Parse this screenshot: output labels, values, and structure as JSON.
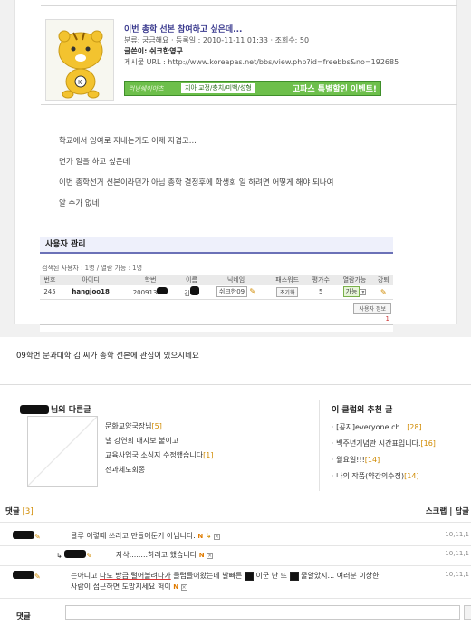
{
  "post": {
    "title": "이번 총학 선본 참여하고 싶은데...",
    "meta_line": "분류: 궁금해요 · 등록일 : 2010-11-11 01:33 · 조회수: 50",
    "author_label": "글쓴이: 쉬크한영구",
    "url_line": "게시물 URL : http://www.koreapas.net/bbs/view.php?id=freebbs&no=192685",
    "banner": {
      "left": "러닝쉐이아츠",
      "middle": "치아 교정/충치/미백/성형",
      "right": "고파스 특별할인 이벤트!"
    },
    "body": [
      "학교에서 잉여로 지내는거도 이제 지겹고...",
      "먼가 일을 하고 싶은데",
      "이번 총학선거 선본이라던가 아님 총학 결정후에 학생회 일 하려면 어떻게 해야 되나여",
      "알 수가 없네"
    ]
  },
  "admin": {
    "title": "사용자 관리",
    "search_info": "검색된 사용자 : 1명 / 열람 가능 : 1명",
    "columns": [
      "번호",
      "아이디",
      "학번",
      "이름",
      "닉네임",
      "패스워드",
      "평가수",
      "열람가능",
      "강퇴"
    ],
    "row": {
      "no": "245",
      "id": "hangjoo18",
      "student_no": "200913",
      "name": "김",
      "nickname": "쉬크한09",
      "password_btn": "초기화",
      "rating": "5",
      "access": "가능",
      "kick": "✎"
    },
    "userinfo_btn": "사용자 정보",
    "page": "1"
  },
  "notice": "09학번 문과대학 김    씨가 총학 선본에 관심이 있으시네요",
  "other_posts": {
    "title_suffix": "님의 다른글",
    "items": [
      {
        "title": "문화교양국장님",
        "count": "[5]"
      },
      {
        "title": "낼 강연회 대자보 붙이고",
        "count": ""
      },
      {
        "title": "교육사업국 소식지 수정했습니다",
        "count": "[1]"
      },
      {
        "title": "전과체도회종",
        "count": ""
      }
    ]
  },
  "recommend": {
    "title": "이 클럽의 추천 글",
    "items": [
      {
        "title": "[공지]everyone ch...",
        "count": "[28]"
      },
      {
        "title": "백주년기념관 시간표입니다.",
        "count": "[16]"
      },
      {
        "title": "월요일!!!",
        "count": "[14]"
      },
      {
        "title": "나의 작품(약간의수정)",
        "count": "[14]"
      }
    ]
  },
  "comments": {
    "label": "댓글",
    "count": "[3]",
    "scrap": "스크랩",
    "reply": "답글",
    "items": [
      {
        "text": "클루 이렇때 쓰라고 만들어둔거 아닙니다.",
        "time": "10,11,1"
      },
      {
        "text": "자삭........하려고 했습니다",
        "time": "10,11,1"
      },
      {
        "text_a": "는아니고",
        "text_b": "나도 방금 털어볼려다가",
        "text_c": " 클럽들어왔는데 발빠른",
        "text_d": "이군 난 또",
        "text_e": "줄알았지... 여러분 이상한",
        "text_f": "사람이 접근하면 도망치세요 헉이",
        "time": "10,11,1"
      }
    ],
    "input_label": "댓글"
  },
  "colors": {
    "accent": "#6b71b7",
    "banner": "#6dbf4b",
    "count": "#d08a00",
    "title": "#3b3b8f"
  }
}
